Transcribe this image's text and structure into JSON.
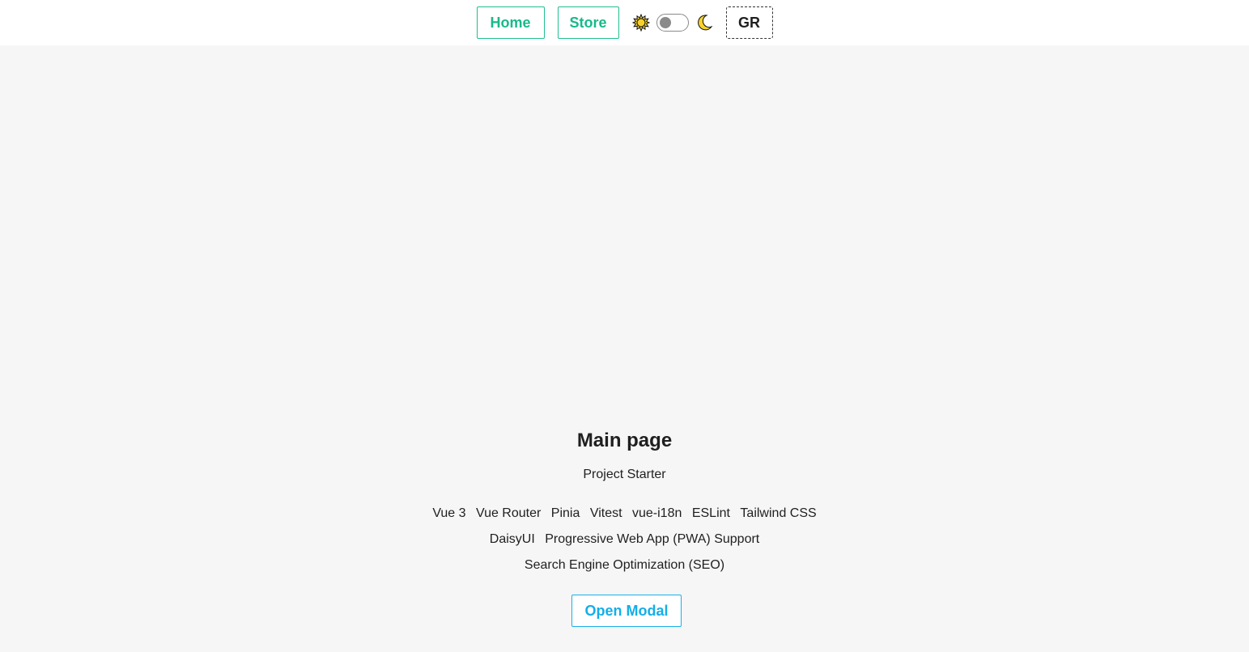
{
  "nav": {
    "home_label": "Home",
    "store_label": "Store",
    "language_label": "GR"
  },
  "theme_toggle": {
    "light_icon": "sun-icon",
    "dark_icon": "moon-icon",
    "state": "light"
  },
  "main": {
    "title": "Main page",
    "subtitle": "Project Starter",
    "features_line1": [
      "Vue 3",
      "Vue Router",
      "Pinia",
      "Vitest",
      "vue-i18n",
      "ESLint",
      "Tailwind CSS"
    ],
    "features_line2": [
      "DaisyUI",
      "Progressive Web App (PWA) Support"
    ],
    "features_line3": [
      "Search Engine Optimization (SEO)"
    ],
    "open_modal_label": "Open Modal"
  },
  "colors": {
    "nav_accent": "#17b98a",
    "modal_accent": "#14aee8",
    "page_background": "#f6f6f6"
  }
}
